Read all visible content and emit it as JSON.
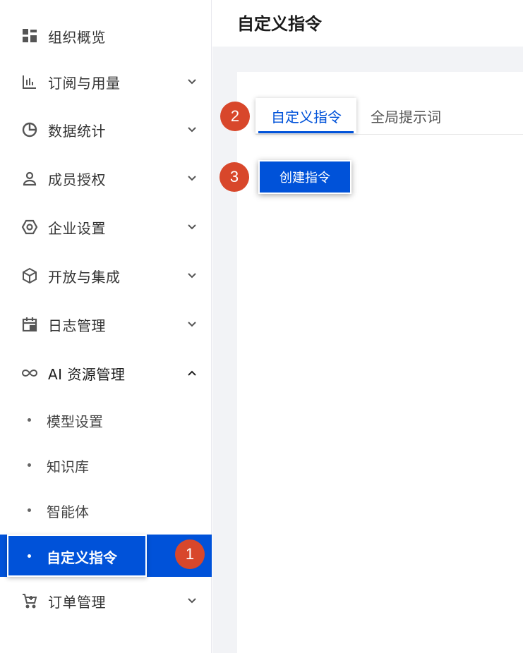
{
  "page": {
    "title": "自定义指令"
  },
  "sidebar": {
    "items": [
      {
        "label": "组织概览",
        "icon": "dashboard-grid-icon"
      },
      {
        "label": "订阅与用量",
        "icon": "bar-chart-icon"
      },
      {
        "label": "数据统计",
        "icon": "pie-chart-icon"
      },
      {
        "label": "成员授权",
        "icon": "user-icon"
      },
      {
        "label": "企业设置",
        "icon": "settings-hexagon-icon"
      },
      {
        "label": "开放与集成",
        "icon": "cube-icon"
      },
      {
        "label": "日志管理",
        "icon": "calendar-log-icon"
      },
      {
        "label": "AI 资源管理",
        "icon": "infinity-icon"
      },
      {
        "label": "订单管理",
        "icon": "cart-icon"
      }
    ],
    "ai_sub_items": [
      "模型设置",
      "知识库",
      "智能体",
      "自定义指令"
    ]
  },
  "tabs": {
    "active": "自定义指令",
    "other": "全局提示词"
  },
  "actions": {
    "create_label": "创建指令"
  },
  "badges": [
    "1",
    "2",
    "3"
  ],
  "colors": {
    "primary": "#0052d9",
    "badge": "#d8472b",
    "background": "#f2f3f6"
  }
}
